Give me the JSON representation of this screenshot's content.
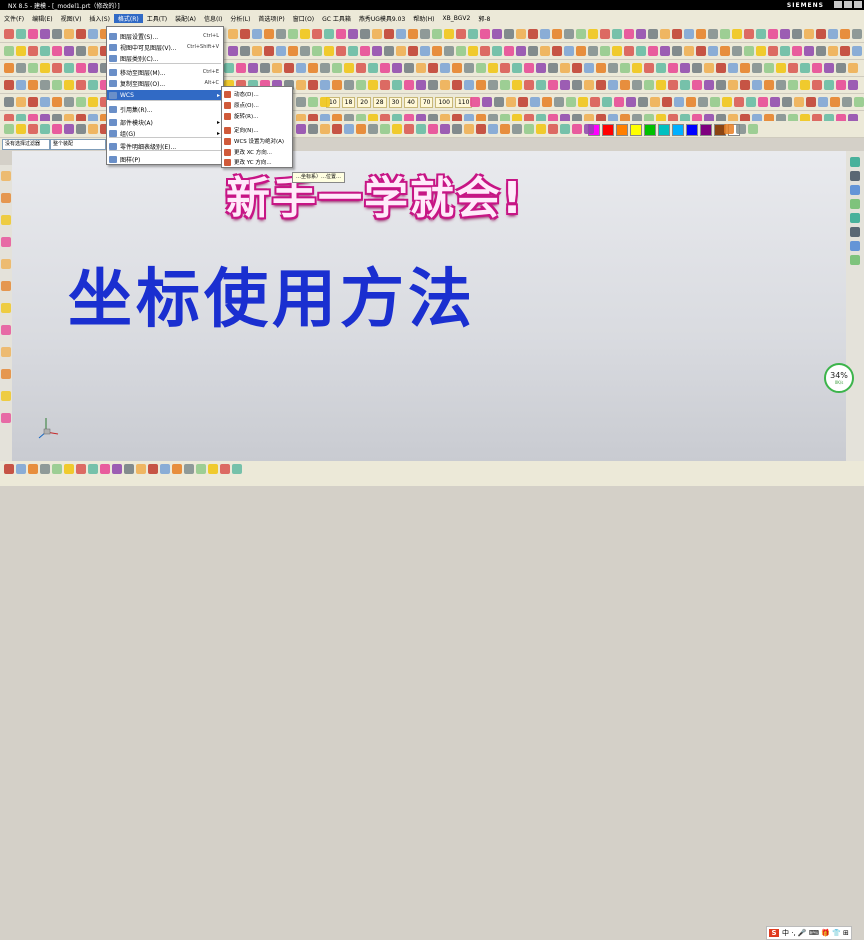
{
  "window": {
    "title": "NX 8.5 - 建模 - [_model1.prt（修改的）]",
    "brand": "SIEMENS"
  },
  "menubar": {
    "items": [
      "文件(F)",
      "编辑(E)",
      "视图(V)",
      "插入(S)",
      "格式(R)",
      "工具(T)",
      "装配(A)",
      "信息(I)",
      "分析(L)",
      "首选项(P)",
      "窗口(O)",
      "GC 工具箱",
      "燕秀UG模具9.03",
      "帮助(H)",
      "XB_BGV2",
      "郭-8"
    ],
    "active_index": 4
  },
  "format_menu": {
    "items": [
      {
        "label": "图层设置(S)...",
        "shortcut": "Ctrl+L"
      },
      {
        "label": "视图中可见图层(V)...",
        "shortcut": "Ctrl+Shift+V"
      },
      {
        "label": "图层类别(C)...",
        "shortcut": ""
      },
      {
        "label": "移动至图层(M)...",
        "shortcut": "Ctrl+E"
      },
      {
        "label": "复制至图层(O)...",
        "shortcut": "Alt+C"
      },
      {
        "label": "WCS",
        "shortcut": ""
      },
      {
        "label": "引用集(R)...",
        "shortcut": ""
      },
      {
        "label": "部件模块(A)",
        "shortcut": ""
      },
      {
        "label": "组(G)",
        "shortcut": ""
      },
      {
        "label": "零件明细表级别(E)...",
        "shortcut": ""
      },
      {
        "label": "图样(P)",
        "shortcut": ""
      }
    ]
  },
  "wcs_submenu": {
    "items": [
      "动态(D)...",
      "原点(O)...",
      "旋转(R)...",
      "定向(N)...",
      "WCS 设置为绝对(A)",
      "更改 XC 方向...",
      "更改 YC 方向..."
    ]
  },
  "number_buttons": [
    "10",
    "18",
    "20",
    "28",
    "30",
    "40",
    "70",
    "100",
    "110"
  ],
  "color_swatches": [
    "#ff00ff",
    "#ff0000",
    "#ff7f00",
    "#ffff00",
    "#00c000",
    "#00c0c0",
    "#00b0ff",
    "#0000ff",
    "#7f007f",
    "#8b4513",
    "#ffffff"
  ],
  "filter": {
    "type_filter": "没有选择过滤器",
    "scope": "整个装配"
  },
  "tooltip": "…坐标系）…位置…",
  "overlay": {
    "subtitle": "新手一学就会!",
    "title": "坐标使用方法"
  },
  "progress": {
    "percent": "34%",
    "speed": "0K/s"
  },
  "tray": {
    "logo": "S",
    "text": "中 ·, 🎤 ⌨ 🎁 👕 ⊞"
  }
}
